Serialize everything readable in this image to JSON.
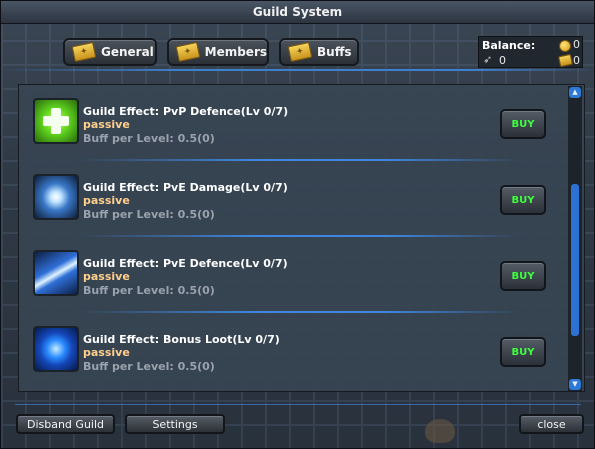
{
  "window": {
    "title": "Guild System"
  },
  "tabs": [
    {
      "label": "General",
      "icon": "ticket-icon"
    },
    {
      "label": "Members",
      "icon": "ticket-icon"
    },
    {
      "label": "Buffs",
      "icon": "ticket-icon"
    }
  ],
  "balance": {
    "label": "Balance:",
    "gold": "0",
    "wing": "0",
    "ticket": "0"
  },
  "items": [
    {
      "name": "Guild Effect: PvP Defence(Lv 0/7)",
      "type": "passive",
      "buff": "Buff per Level: 0.5(0)",
      "buy_label": "BUY",
      "icon": "green-cross-icon"
    },
    {
      "name": "Guild Effect: PvE Damage(Lv 0/7)",
      "type": "passive",
      "buff": "Buff per Level: 0.5(0)",
      "buy_label": "BUY",
      "icon": "light-burst-icon"
    },
    {
      "name": "Guild Effect: PvE Defence(Lv 0/7)",
      "type": "passive",
      "buff": "Buff per Level: 0.5(0)",
      "buy_label": "BUY",
      "icon": "lightning-icon"
    },
    {
      "name": "Guild Effect: Bonus Loot(Lv 0/7)",
      "type": "passive",
      "buff": "Buff per Level: 0.5(0)",
      "buy_label": "BUY",
      "icon": "blue-orb-icon"
    }
  ],
  "footer": {
    "disband_label": "Disband Guild",
    "settings_label": "Settings",
    "close_label": "close"
  },
  "colors": {
    "title_text": "#f0f0f0",
    "item_name": "#ffffff",
    "passive": "#ffcf8c",
    "buff_text": "#9aa3ad",
    "buy_text": "#3cff3c",
    "accent_line": "#3f7fd0",
    "scrollbar": "#2d72d2"
  }
}
